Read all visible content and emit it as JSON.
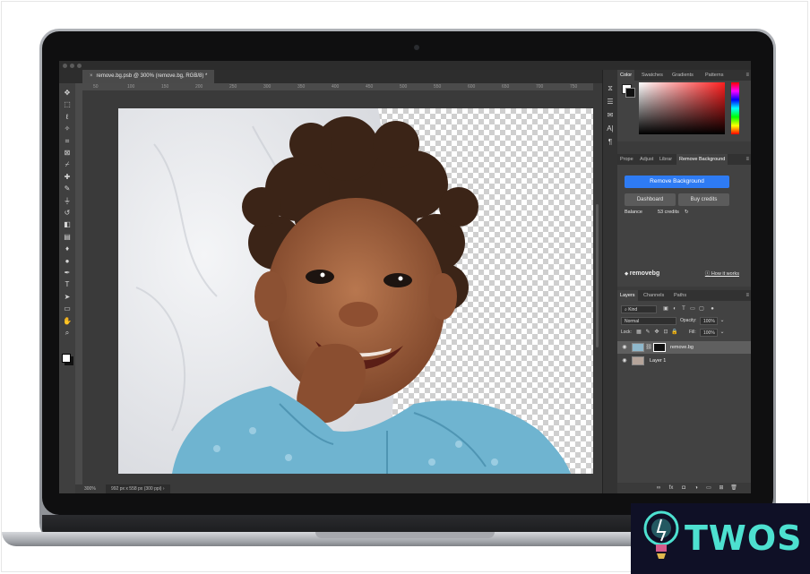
{
  "document": {
    "tab_title": "remove.bg.psb @ 300% (remove.bg, RGB/8) *",
    "close_glyph": "×",
    "zoom": "300%",
    "info": "992 px x 558 px (300 ppi)",
    "status_arrow": "›"
  },
  "ruler": {
    "ticks": [
      "50",
      "100",
      "150",
      "200",
      "250",
      "300",
      "350",
      "400",
      "450",
      "500",
      "550",
      "600",
      "650",
      "700",
      "750"
    ]
  },
  "tools": [
    {
      "icon": "move-icon",
      "glyph": "✥"
    },
    {
      "icon": "marquee-icon",
      "glyph": "⬚"
    },
    {
      "icon": "lasso-icon",
      "glyph": "ℓ"
    },
    {
      "icon": "magic-wand-icon",
      "glyph": "✧"
    },
    {
      "icon": "crop-icon",
      "glyph": "⌗"
    },
    {
      "icon": "frame-icon",
      "glyph": "⊠"
    },
    {
      "icon": "eyedropper-icon",
      "glyph": "⌿"
    },
    {
      "icon": "healing-brush-icon",
      "glyph": "✚"
    },
    {
      "icon": "brush-icon",
      "glyph": "✎"
    },
    {
      "icon": "stamp-icon",
      "glyph": "⏚"
    },
    {
      "icon": "history-brush-icon",
      "glyph": "↺"
    },
    {
      "icon": "eraser-icon",
      "glyph": "◧"
    },
    {
      "icon": "gradient-icon",
      "glyph": "▤"
    },
    {
      "icon": "blur-icon",
      "glyph": "♦"
    },
    {
      "icon": "dodge-icon",
      "glyph": "●"
    },
    {
      "icon": "pen-icon",
      "glyph": "✒"
    },
    {
      "icon": "type-icon",
      "glyph": "T"
    },
    {
      "icon": "path-select-icon",
      "glyph": "➤"
    },
    {
      "icon": "rectangle-icon",
      "glyph": "▭"
    },
    {
      "icon": "hand-icon",
      "glyph": "✋"
    },
    {
      "icon": "zoom-icon",
      "glyph": "⌕"
    }
  ],
  "mini_panel_icons": [
    {
      "icon": "history-icon",
      "glyph": "⧖"
    },
    {
      "icon": "properties-icon",
      "glyph": "☰"
    },
    {
      "icon": "comment-icon",
      "glyph": "✉"
    },
    {
      "icon": "character-icon",
      "glyph": "A|"
    },
    {
      "icon": "paragraph-icon",
      "glyph": "¶"
    }
  ],
  "color_panel": {
    "tabs": [
      "Color",
      "Swatches",
      "Gradients",
      "Patterns"
    ],
    "active_tab": "Color",
    "menu_glyph": "≡"
  },
  "removebg_panel": {
    "tabs": [
      "Prope",
      "Adjust",
      "Librar",
      "Remove Background"
    ],
    "remove_button": "Remove Background",
    "dashboard_button": "Dashboard",
    "buy_credits_button": "Buy credits",
    "balance_label": "Balance",
    "credits": "53 credits",
    "refresh_glyph": "↻",
    "logo_text": "remove",
    "logo_suffix": "bg",
    "how_it_works": "How it works",
    "accent": "#2e7bf3"
  },
  "layers_panel": {
    "tabs": [
      "Layers",
      "Channels",
      "Paths"
    ],
    "kind_filter": "Kind",
    "blend_mode": "Normal",
    "opacity_label": "Opacity:",
    "opacity_value": "100%",
    "lock_label": "Lock:",
    "fill_label": "Fill:",
    "fill_value": "100%",
    "dropdown_glyph": "⌄",
    "layers": [
      {
        "name": "remove.bg",
        "selected": true,
        "has_mask": true
      },
      {
        "name": "Layer 1",
        "selected": false,
        "has_mask": false
      }
    ],
    "bottom_icons": [
      "link-icon",
      "fx-icon",
      "mask-icon",
      "adjustment-icon",
      "group-icon",
      "new-layer-icon",
      "trash-icon"
    ],
    "bottom_glyphs": [
      "∞",
      "fx",
      "◘",
      "◑",
      "▭",
      "⊞",
      "🗑"
    ]
  },
  "watermark": {
    "text": "TWOS",
    "color": "#4de0d0"
  }
}
